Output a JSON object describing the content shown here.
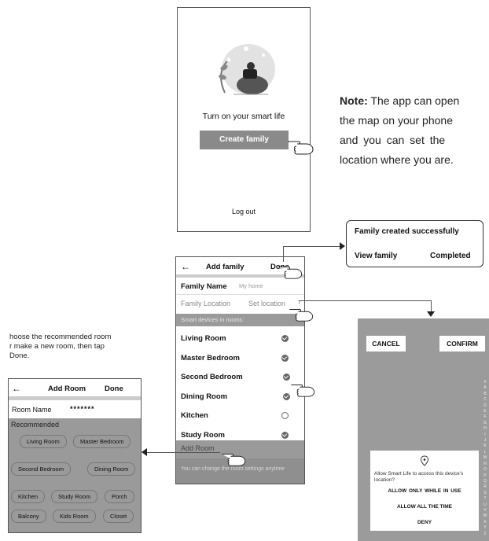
{
  "screen1": {
    "tagline": "Turn on your smart life",
    "create_family": "Create family",
    "log_out": "Log out"
  },
  "note": {
    "bold": "Note:",
    "line1": "The app can open",
    "line2": "the map on your phone",
    "line3": "and you can set the",
    "line4": "location where you are."
  },
  "popup": {
    "title": "Family created successfully",
    "view_family": "View family",
    "completed": "Completed"
  },
  "add_family": {
    "back": "←",
    "title": "Add family",
    "done": "Done",
    "family_name_label": "Family Name",
    "family_name_placeholder": "My home",
    "family_location_label": "Family Location",
    "set_location": "Set location",
    "section_header": "Smart devices in rooms:",
    "rooms": [
      {
        "name": "Living Room",
        "checked": true
      },
      {
        "name": "Master Bedroom",
        "checked": true
      },
      {
        "name": "Second Bedroom",
        "checked": true
      },
      {
        "name": "Dining Room",
        "checked": true
      },
      {
        "name": "Kitchen",
        "checked": false
      },
      {
        "name": "Study Room",
        "checked": true
      }
    ],
    "add_room": "Add Room",
    "footer": "You can change the room settings anytime"
  },
  "instruction": {
    "line1": "hoose the recommended room",
    "line2": "r make a new room, then tap",
    "line3": "Done."
  },
  "add_room": {
    "back": "←",
    "title": "Add Room",
    "done": "Done",
    "room_name_label": "Room Name",
    "room_name_value": "*******",
    "recommended": "Recommended",
    "pills": [
      "Living Room",
      "Master Bedroom",
      "Second Bedroom",
      "Dining Room",
      "Kitchen",
      "Study Room",
      "Porch",
      "Balcony",
      "Kids Room",
      "Closet"
    ]
  },
  "map": {
    "cancel": "CANCEL",
    "confirm": "CONFIRM",
    "alphabet": [
      "#",
      "A",
      "B",
      "C",
      "D",
      "E",
      "F",
      "G",
      "H",
      "I",
      "J",
      "K",
      "L",
      "M",
      "N",
      "O",
      "P",
      "Q",
      "R",
      "S",
      "T",
      "U",
      "V",
      "W",
      "X",
      "Y",
      "Z"
    ],
    "dialog_text": "Allow Smart Life to access this device's location?",
    "allow_in_use": "ALLOW  ONLY WHILE IN USE",
    "allow_always": "ALLOW  ALL THE TIME",
    "deny": "DENY"
  }
}
